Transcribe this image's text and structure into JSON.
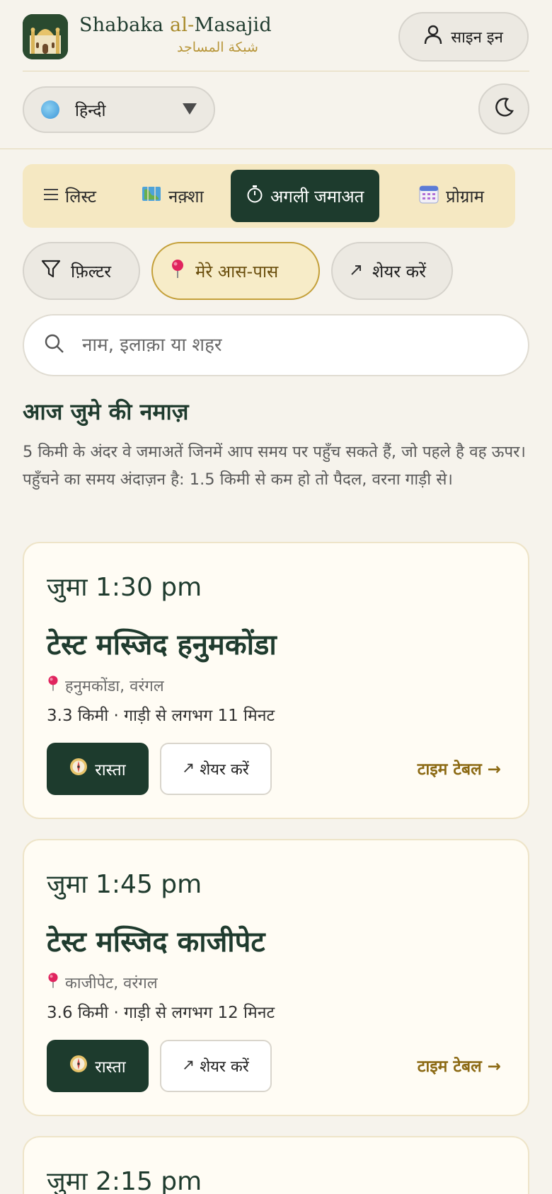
{
  "brand": {
    "name_prefix": "Shabaka ",
    "name_al": "al-",
    "name_suffix": "Masajid",
    "arabic": "شبكة المساجد"
  },
  "header": {
    "signin_label": "साइन इन",
    "language": "हिन्दी"
  },
  "tabs": [
    {
      "label": "लिस्ट",
      "icon": "list-icon"
    },
    {
      "label": "नक़्शा",
      "icon": "map-icon"
    },
    {
      "label": "अगली जमाअत",
      "icon": "stopwatch-icon",
      "active": true
    },
    {
      "label": "प्रोग्राम",
      "icon": "calendar-icon"
    }
  ],
  "chips": {
    "filter": "फ़िल्टर",
    "nearby": "मेरे आस-पास",
    "share": "शेयर करें"
  },
  "search": {
    "placeholder": "नाम, इलाक़ा या शहर"
  },
  "section": {
    "title": "आज जुमे की नमाज़",
    "description": "5 किमी के अंदर वे जमाअतें जिनमें आप समय पर पहुँच सकते हैं, जो पहले है वह ऊपर। पहुँचने का समय अंदाज़न है: 1.5 किमी से कम हो तो पैदल, वरना गाड़ी से।"
  },
  "cards": [
    {
      "time": "जुमा 1:30 pm",
      "name": "टेस्ट मस्जिद हनुमकोंडा",
      "area": "हनुमकोंडा, वरंगल",
      "distance": "3.3 किमी · गाड़ी से लगभग 11 मिनट",
      "route_label": "रास्ता",
      "share_label": "शेयर करें",
      "timetable_label": "टाइम टेबल →"
    },
    {
      "time": "जुमा 1:45 pm",
      "name": "टेस्ट मस्जिद काजीपेट",
      "area": "काजीपेट, वरंगल",
      "distance": "3.6 किमी · गाड़ी से लगभग 12 मिनट",
      "route_label": "रास्ता",
      "share_label": "शेयर करें",
      "timetable_label": "टाइम टेबल →"
    },
    {
      "time": "जुमा 2:15 pm"
    }
  ],
  "colors": {
    "background": "#f6f3ec",
    "primary": "#1d3b2d",
    "accent_gold": "#b8963a",
    "tab_bar": "#f5e8c2"
  }
}
